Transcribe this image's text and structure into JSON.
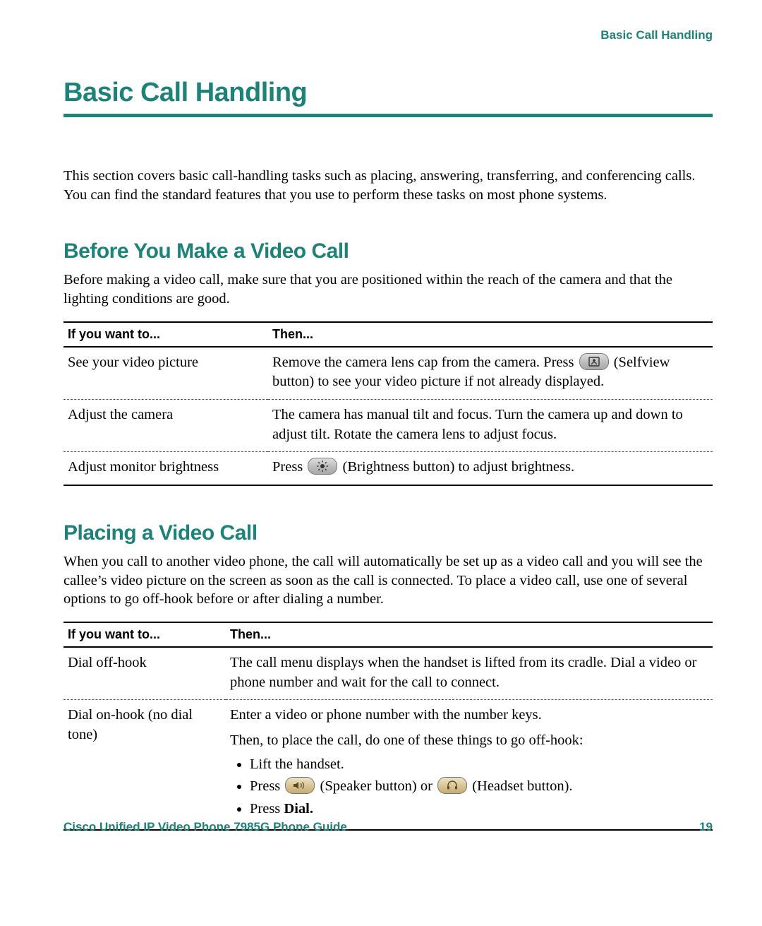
{
  "header": {
    "section": "Basic Call Handling"
  },
  "title": "Basic Call Handling",
  "intro": "This section covers basic call-handling tasks such as placing, answering, transferring, and conferencing calls. You can find the standard features that you use to perform these tasks on most phone systems.",
  "before": {
    "heading": "Before You Make a Video Call",
    "para": "Before making a video call, make sure that you are positioned within the reach of the camera and that the lighting conditions are good.",
    "th1": "If you want to...",
    "th2": "Then...",
    "r1c1": "See your video picture",
    "r1c2a": "Remove the camera lens cap from the camera. Press ",
    "r1c2b": " (Selfview button) to see your video picture if not already displayed.",
    "r2c1": "Adjust the camera",
    "r2c2": "The camera has manual tilt and focus. Turn the camera up and down to adjust tilt. Rotate the camera lens to adjust focus.",
    "r3c1": "Adjust monitor brightness",
    "r3c2a": "Press ",
    "r3c2b": " (Brightness button) to adjust brightness."
  },
  "placing": {
    "heading": "Placing a Video Call",
    "para": "When you call to another video phone, the call will automatically be set up as a video call and you will see the callee’s video picture on the screen as soon as the call is connected. To place a video call, use one of several options to go off-hook before or after dialing a number.",
    "th1": "If you want to...",
    "th2": "Then...",
    "r1c1": "Dial off-hook",
    "r1c2": "The call menu displays when the handset is lifted from its cradle. Dial a video or phone number and wait for the call to connect.",
    "r2c1": "Dial on-hook (no dial tone)",
    "r2c2_line1": "Enter a video or phone number with the number keys.",
    "r2c2_line2": "Then, to place the call, do one of these things to go off-hook:",
    "b1": "Lift the handset.",
    "b2a": "Press ",
    "b2b": " (Speaker button) or ",
    "b2c": " (Headset button).",
    "b3a": "Press ",
    "b3b": "Dial."
  },
  "footer": {
    "doc": "Cisco Unified IP Video Phone 7985G Phone Guide",
    "page": "19"
  }
}
